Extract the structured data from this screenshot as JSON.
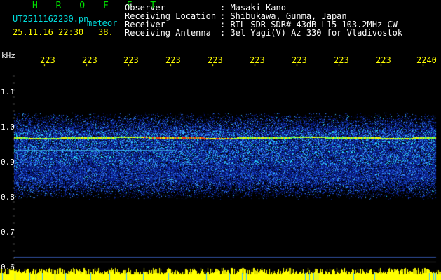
{
  "header": {
    "title": "H R O F F T",
    "file": "UT2511162230.pn",
    "file_ext": "meteor",
    "datetime": "25.11.16 22:30",
    "count": "38."
  },
  "meta": {
    "labels": [
      "Observer",
      "Receiving Location",
      "Receiver",
      "Receiving Antenna"
    ],
    "values": [
      ": Masaki Kano",
      ": Shibukawa, Gunma, Japan",
      ": RTL-SDR SDR# 43dB L15 103.2MHz CW",
      ": 3el Yagi(V) Az 330 for Vladivostok"
    ]
  },
  "axis": {
    "unit": "kHz",
    "x_ticks": [
      "223",
      "223",
      "223",
      "223",
      "223",
      "223",
      "223",
      "223",
      "223",
      "2240"
    ],
    "y_ticks": [
      "1.1",
      "1.0",
      "0.9",
      "0.8",
      "0.7",
      "0.6"
    ]
  },
  "colors": {
    "background": "#000000",
    "header_green": "#00e000",
    "tick_yellow": "#ffff00",
    "spectrum_low": "#0a1f8c",
    "spectrum_mid": "#2f7fff",
    "spectrum_high": "#00ffff",
    "echo_line": "#ffff00",
    "echo_peak": "#ff3300"
  }
}
